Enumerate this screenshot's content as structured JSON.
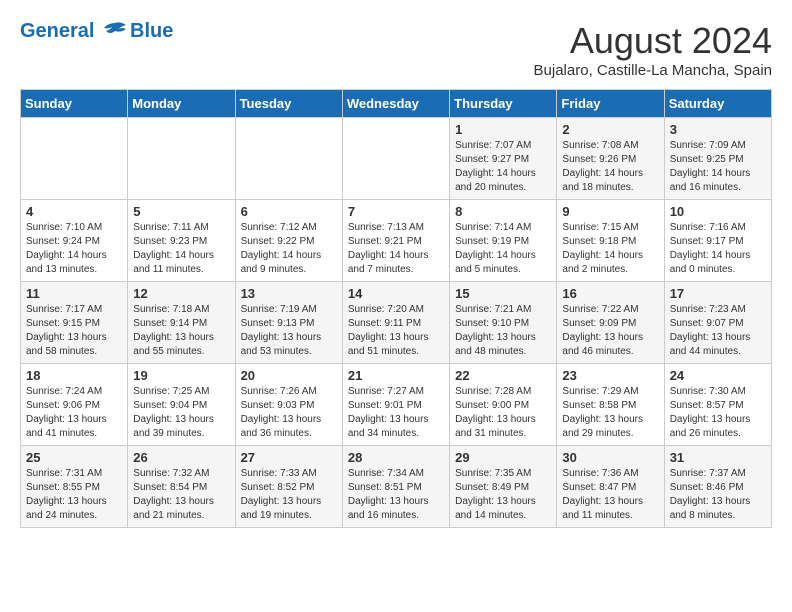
{
  "header": {
    "logo_line1": "General",
    "logo_line2": "Blue",
    "month": "August 2024",
    "location": "Bujalaro, Castille-La Mancha, Spain"
  },
  "days_of_week": [
    "Sunday",
    "Monday",
    "Tuesday",
    "Wednesday",
    "Thursday",
    "Friday",
    "Saturday"
  ],
  "weeks": [
    [
      {
        "day": "",
        "content": ""
      },
      {
        "day": "",
        "content": ""
      },
      {
        "day": "",
        "content": ""
      },
      {
        "day": "",
        "content": ""
      },
      {
        "day": "1",
        "content": "Sunrise: 7:07 AM\nSunset: 9:27 PM\nDaylight: 14 hours\nand 20 minutes."
      },
      {
        "day": "2",
        "content": "Sunrise: 7:08 AM\nSunset: 9:26 PM\nDaylight: 14 hours\nand 18 minutes."
      },
      {
        "day": "3",
        "content": "Sunrise: 7:09 AM\nSunset: 9:25 PM\nDaylight: 14 hours\nand 16 minutes."
      }
    ],
    [
      {
        "day": "4",
        "content": "Sunrise: 7:10 AM\nSunset: 9:24 PM\nDaylight: 14 hours\nand 13 minutes."
      },
      {
        "day": "5",
        "content": "Sunrise: 7:11 AM\nSunset: 9:23 PM\nDaylight: 14 hours\nand 11 minutes."
      },
      {
        "day": "6",
        "content": "Sunrise: 7:12 AM\nSunset: 9:22 PM\nDaylight: 14 hours\nand 9 minutes."
      },
      {
        "day": "7",
        "content": "Sunrise: 7:13 AM\nSunset: 9:21 PM\nDaylight: 14 hours\nand 7 minutes."
      },
      {
        "day": "8",
        "content": "Sunrise: 7:14 AM\nSunset: 9:19 PM\nDaylight: 14 hours\nand 5 minutes."
      },
      {
        "day": "9",
        "content": "Sunrise: 7:15 AM\nSunset: 9:18 PM\nDaylight: 14 hours\nand 2 minutes."
      },
      {
        "day": "10",
        "content": "Sunrise: 7:16 AM\nSunset: 9:17 PM\nDaylight: 14 hours\nand 0 minutes."
      }
    ],
    [
      {
        "day": "11",
        "content": "Sunrise: 7:17 AM\nSunset: 9:15 PM\nDaylight: 13 hours\nand 58 minutes."
      },
      {
        "day": "12",
        "content": "Sunrise: 7:18 AM\nSunset: 9:14 PM\nDaylight: 13 hours\nand 55 minutes."
      },
      {
        "day": "13",
        "content": "Sunrise: 7:19 AM\nSunset: 9:13 PM\nDaylight: 13 hours\nand 53 minutes."
      },
      {
        "day": "14",
        "content": "Sunrise: 7:20 AM\nSunset: 9:11 PM\nDaylight: 13 hours\nand 51 minutes."
      },
      {
        "day": "15",
        "content": "Sunrise: 7:21 AM\nSunset: 9:10 PM\nDaylight: 13 hours\nand 48 minutes."
      },
      {
        "day": "16",
        "content": "Sunrise: 7:22 AM\nSunset: 9:09 PM\nDaylight: 13 hours\nand 46 minutes."
      },
      {
        "day": "17",
        "content": "Sunrise: 7:23 AM\nSunset: 9:07 PM\nDaylight: 13 hours\nand 44 minutes."
      }
    ],
    [
      {
        "day": "18",
        "content": "Sunrise: 7:24 AM\nSunset: 9:06 PM\nDaylight: 13 hours\nand 41 minutes."
      },
      {
        "day": "19",
        "content": "Sunrise: 7:25 AM\nSunset: 9:04 PM\nDaylight: 13 hours\nand 39 minutes."
      },
      {
        "day": "20",
        "content": "Sunrise: 7:26 AM\nSunset: 9:03 PM\nDaylight: 13 hours\nand 36 minutes."
      },
      {
        "day": "21",
        "content": "Sunrise: 7:27 AM\nSunset: 9:01 PM\nDaylight: 13 hours\nand 34 minutes."
      },
      {
        "day": "22",
        "content": "Sunrise: 7:28 AM\nSunset: 9:00 PM\nDaylight: 13 hours\nand 31 minutes."
      },
      {
        "day": "23",
        "content": "Sunrise: 7:29 AM\nSunset: 8:58 PM\nDaylight: 13 hours\nand 29 minutes."
      },
      {
        "day": "24",
        "content": "Sunrise: 7:30 AM\nSunset: 8:57 PM\nDaylight: 13 hours\nand 26 minutes."
      }
    ],
    [
      {
        "day": "25",
        "content": "Sunrise: 7:31 AM\nSunset: 8:55 PM\nDaylight: 13 hours\nand 24 minutes."
      },
      {
        "day": "26",
        "content": "Sunrise: 7:32 AM\nSunset: 8:54 PM\nDaylight: 13 hours\nand 21 minutes."
      },
      {
        "day": "27",
        "content": "Sunrise: 7:33 AM\nSunset: 8:52 PM\nDaylight: 13 hours\nand 19 minutes."
      },
      {
        "day": "28",
        "content": "Sunrise: 7:34 AM\nSunset: 8:51 PM\nDaylight: 13 hours\nand 16 minutes."
      },
      {
        "day": "29",
        "content": "Sunrise: 7:35 AM\nSunset: 8:49 PM\nDaylight: 13 hours\nand 14 minutes."
      },
      {
        "day": "30",
        "content": "Sunrise: 7:36 AM\nSunset: 8:47 PM\nDaylight: 13 hours\nand 11 minutes."
      },
      {
        "day": "31",
        "content": "Sunrise: 7:37 AM\nSunset: 8:46 PM\nDaylight: 13 hours\nand 8 minutes."
      }
    ]
  ]
}
